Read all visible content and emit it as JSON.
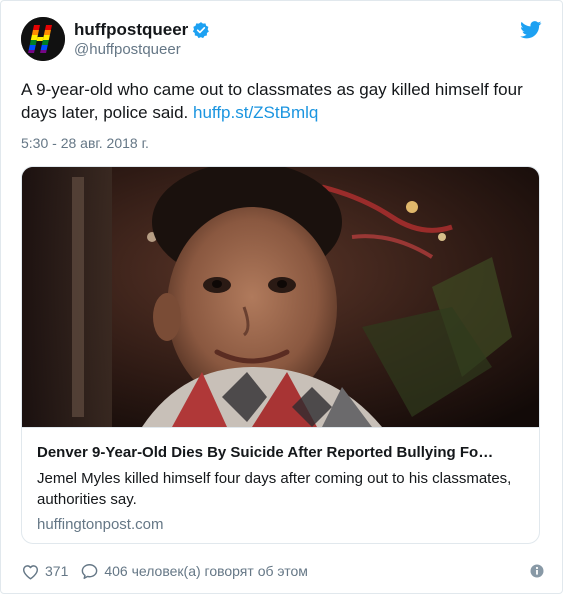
{
  "user": {
    "display_name": "huffpostqueer",
    "handle": "@huffpostqueer",
    "avatar_icon": "rainbow-h-logo-icon",
    "verified_icon": "verified-badge-icon"
  },
  "brand_icon": "twitter-bird-icon",
  "tweet": {
    "text": "A 9-year-old who came out to classmates as gay killed himself four days later, police said.",
    "link_text": "huffp.st/ZStBmlq",
    "timestamp": "5:30 - 28 авг. 2018 г."
  },
  "card": {
    "image": "photo-boy-smiling",
    "title": "Denver 9-Year-Old Dies By Suicide After Reported Bullying Fo…",
    "description": "Jemel Myles killed himself four days after coming out to his classmates, authorities say.",
    "domain": "huffingtonpost.com"
  },
  "footer": {
    "likes": "371",
    "like_icon": "heart-icon",
    "reply_icon": "speech-bubble-icon",
    "talking_text": "406 человек(а) говорят об этом",
    "info_icon": "info-icon"
  },
  "colors": {
    "link": "#1b95e0",
    "text": "#14171a",
    "secondary": "#657786",
    "verified": "#1da1f2",
    "twitter_blue": "#1da1f2",
    "border": "#e1e8ed"
  }
}
